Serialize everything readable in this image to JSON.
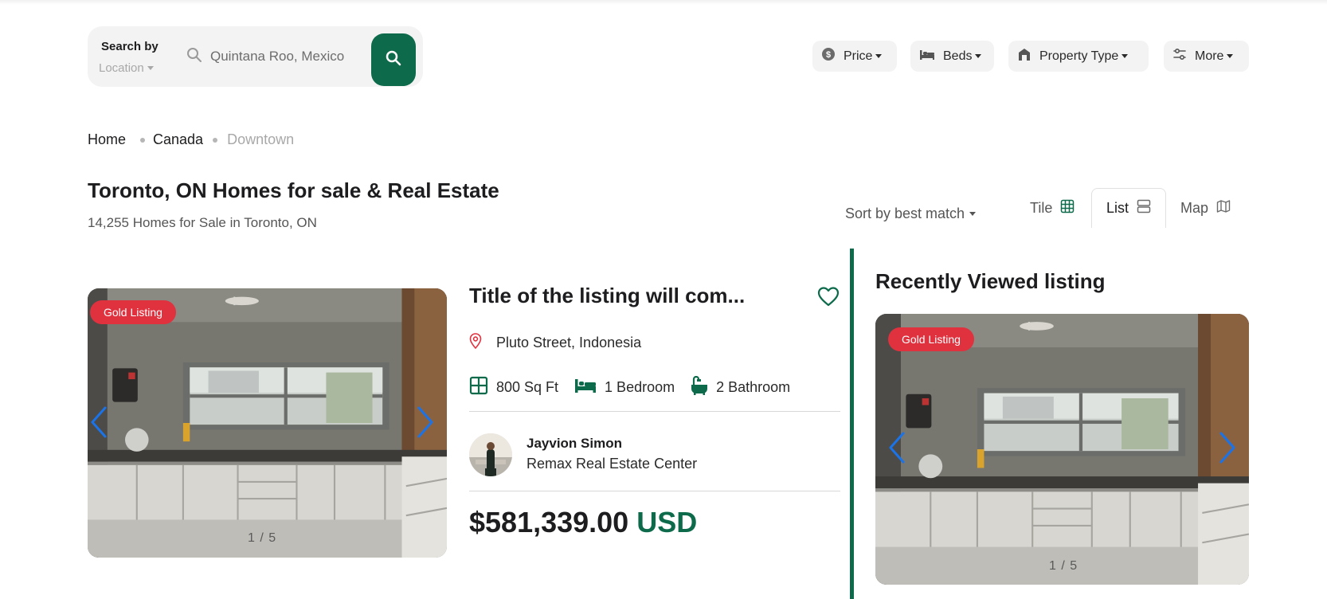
{
  "search": {
    "by_label": "Search by",
    "location_label": "Location",
    "placeholder": "Quintana Roo, Mexico"
  },
  "filters": [
    {
      "label": "Price",
      "icon": "dollar-coin-icon"
    },
    {
      "label": "Beds",
      "icon": "bed-icon"
    },
    {
      "label": "Property Type",
      "icon": "house-icon"
    },
    {
      "label": "More",
      "icon": "sliders-icon"
    }
  ],
  "breadcrumb": [
    "Home",
    "Canada",
    "Downtown"
  ],
  "page": {
    "title": "Toronto, ON Homes for sale & Real Estate",
    "result_count": "14,255 Homes for Sale in Toronto, ON"
  },
  "sort": {
    "label": "Sort by best match"
  },
  "view_tabs": [
    {
      "label": "Tile",
      "icon": "grid-icon"
    },
    {
      "label": "List",
      "icon": "list-icon",
      "active": true
    },
    {
      "label": "Map",
      "icon": "map-icon"
    }
  ],
  "listing": {
    "badge": "Gold Listing",
    "photo_counter": "1 / 5",
    "title": "Title of the listing will com...",
    "address": "Pluto Street, Indonesia",
    "area": "800 Sq Ft",
    "bedrooms": "1 Bedroom",
    "bathrooms": "2 Bathroom",
    "agent_name": "Jayvion Simon",
    "agent_company": "Remax Real Estate Center",
    "price": "$581,339.00",
    "currency": "USD"
  },
  "recent": {
    "title": "Recently Viewed listing",
    "badge": "Gold Listing",
    "photo_counter": "1 / 5"
  },
  "colors": {
    "brand_green": "#0d6b4b",
    "badge_red": "#e0313f",
    "arrow_blue": "#1a73e8"
  }
}
